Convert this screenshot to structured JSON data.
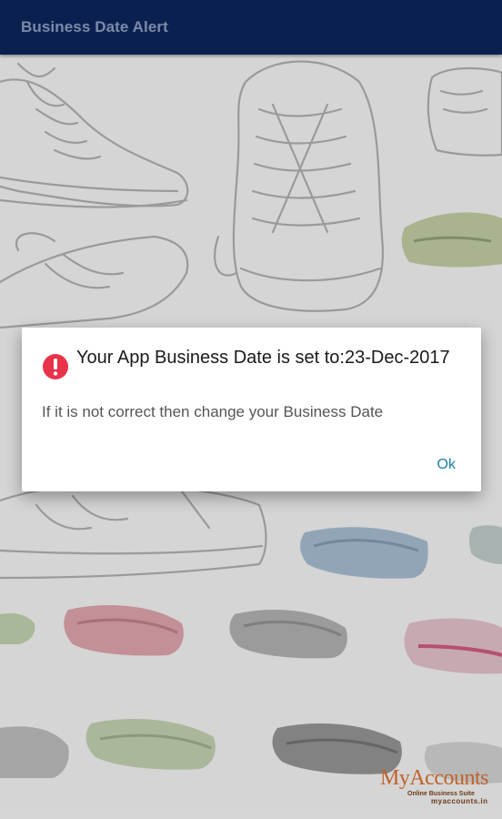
{
  "appbar": {
    "title": "Business Date Alert"
  },
  "dialog": {
    "icon": "alert-error-icon",
    "title": "Your App Business Date is set to:23-Dec-2017",
    "message": "If it is not correct then change your Business Date",
    "ok_label": "Ok"
  },
  "logo": {
    "name": "MyAccounts",
    "tagline": "Online Business Suite",
    "url": "myaccounts.in"
  },
  "colors": {
    "appbar": "#0a2150",
    "accent": "#1a7fae",
    "alert_icon": "#e8334b",
    "logo": "#c0632a"
  }
}
